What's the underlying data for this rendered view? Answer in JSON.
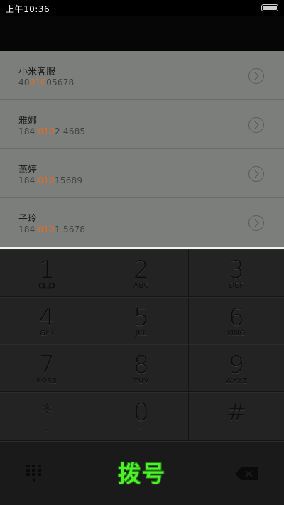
{
  "status_bar": {
    "time": "上午10:36"
  },
  "results": [
    {
      "name": "小米客服",
      "num_pre": "40",
      "num_hl": "010",
      "num_post": "05678"
    },
    {
      "name": "雅娜",
      "num_pre": "184 ",
      "num_hl": "010",
      "num_post": "2 4685"
    },
    {
      "name": "燕婷",
      "num_pre": "184 ",
      "num_hl": "010",
      "num_post": "15689"
    },
    {
      "name": "子玲",
      "num_pre": "184 ",
      "num_hl": "010",
      "num_post": "1 5678"
    }
  ],
  "keys": [
    {
      "digit": "1",
      "sub": ""
    },
    {
      "digit": "2",
      "sub": "ABC"
    },
    {
      "digit": "3",
      "sub": "DEF"
    },
    {
      "digit": "4",
      "sub": "GHI"
    },
    {
      "digit": "5",
      "sub": "JKL"
    },
    {
      "digit": "6",
      "sub": "MNO"
    },
    {
      "digit": "7",
      "sub": "PQRS"
    },
    {
      "digit": "8",
      "sub": "TUV"
    },
    {
      "digit": "9",
      "sub": "WXYZ"
    },
    {
      "digit": "*",
      "sub": ","
    },
    {
      "digit": "0",
      "sub": "+"
    },
    {
      "digit": "#",
      "sub": ""
    }
  ],
  "action_bar": {
    "dial_label": "拨号"
  },
  "icons": {
    "voicemail": "voicemail-icon",
    "keypad_toggle": "dialpad-icon",
    "backspace": "backspace-icon",
    "chevron": "chevron-right-icon"
  },
  "colors": {
    "highlight": "#e86c1b",
    "dial_green": "#4ff02a",
    "list_bg": "#7c7e7b",
    "keypad_bg": "#232323"
  }
}
